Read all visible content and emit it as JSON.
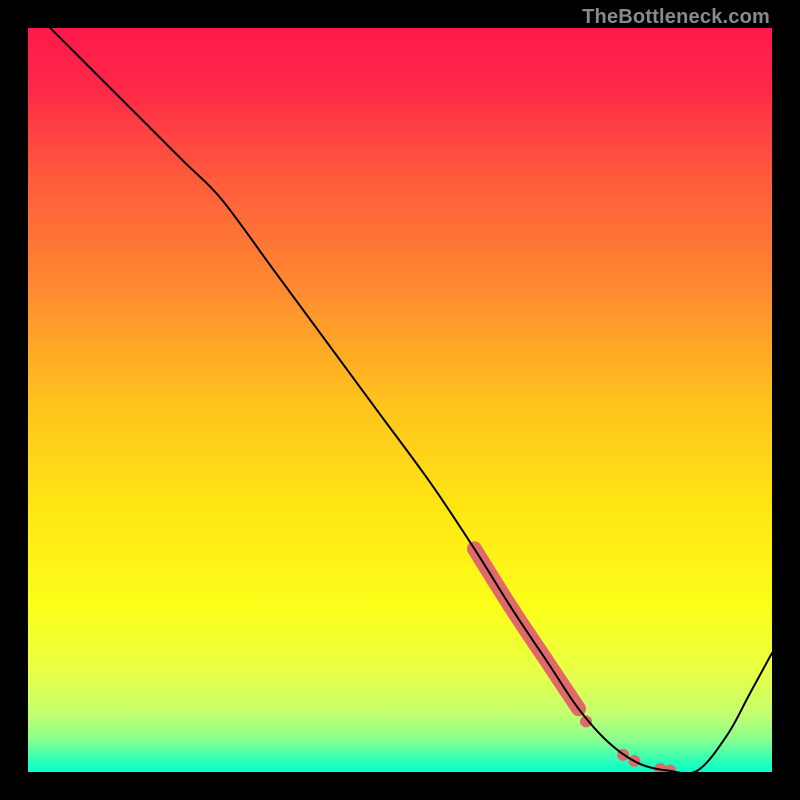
{
  "watermark": "TheBottleneck.com",
  "chart_data": {
    "type": "line",
    "title": "",
    "xlabel": "",
    "ylabel": "",
    "xlim": [
      0,
      100
    ],
    "ylim": [
      0,
      100
    ],
    "gradient_stops": [
      {
        "offset": 0.0,
        "color": "#ff1a4b"
      },
      {
        "offset": 0.08,
        "color": "#ff2848"
      },
      {
        "offset": 0.2,
        "color": "#ff5a3c"
      },
      {
        "offset": 0.35,
        "color": "#ff8a30"
      },
      {
        "offset": 0.5,
        "color": "#ffc21e"
      },
      {
        "offset": 0.65,
        "color": "#ffe713"
      },
      {
        "offset": 0.78,
        "color": "#fbff1a"
      },
      {
        "offset": 0.86,
        "color": "#eaff42"
      },
      {
        "offset": 0.92,
        "color": "#c6ff6e"
      },
      {
        "offset": 0.955,
        "color": "#8dff8d"
      },
      {
        "offset": 0.975,
        "color": "#4cffa8"
      },
      {
        "offset": 0.99,
        "color": "#1effc0"
      },
      {
        "offset": 1.0,
        "color": "#07ffc8"
      }
    ],
    "series": [
      {
        "name": "bottleneck-curve",
        "color": "#000000",
        "x": [
          0.0,
          7.0,
          14.0,
          21.0,
          26.0,
          33.0,
          40.0,
          47.0,
          54.0,
          60.0,
          65.0,
          70.0,
          74.0,
          78.0,
          82.0,
          86.0,
          90.0,
          94.0,
          97.0,
          100.0
        ],
        "y": [
          103.0,
          96.0,
          89.0,
          82.0,
          77.0,
          67.5,
          58.0,
          48.5,
          39.0,
          30.0,
          22.0,
          14.5,
          8.5,
          4.0,
          1.2,
          0.2,
          0.2,
          5.0,
          10.5,
          16.0
        ]
      }
    ],
    "highlight_segment": {
      "name": "highlighted-range",
      "color": "#e06a6a",
      "stroke_width_px": 15,
      "x": [
        60.0,
        65.0,
        70.0,
        74.0
      ],
      "y": [
        30.0,
        22.0,
        14.5,
        8.5
      ]
    },
    "highlight_dots": {
      "name": "highlight-dots",
      "color": "#e06a6a",
      "radius_px": 6,
      "points": [
        {
          "x": 75.0,
          "y": 6.8
        },
        {
          "x": 80.0,
          "y": 2.3
        },
        {
          "x": 81.5,
          "y": 1.5
        },
        {
          "x": 85.0,
          "y": 0.4
        },
        {
          "x": 86.3,
          "y": 0.2
        }
      ]
    }
  }
}
